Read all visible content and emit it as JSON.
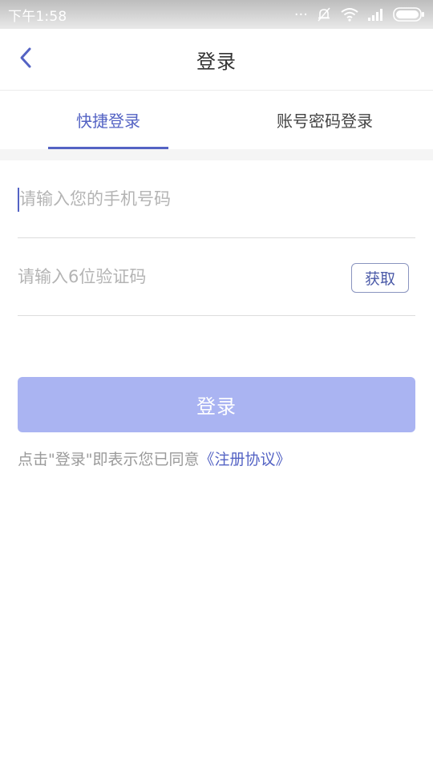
{
  "status_bar": {
    "time": "下午1:58",
    "dots": "..."
  },
  "header": {
    "title": "登录"
  },
  "tabs": [
    {
      "label": "快捷登录",
      "active": true
    },
    {
      "label": "账号密码登录",
      "active": false
    }
  ],
  "form": {
    "phone_placeholder": "请输入您的手机号码",
    "code_placeholder": "请输入6位验证码",
    "get_code_label": "获取"
  },
  "login_button": {
    "label": "登录"
  },
  "agreement": {
    "text": "点击\"登录\"即表示您已同意",
    "link": "《注册协议》"
  },
  "colors": {
    "accent": "#5463c4",
    "button_bg": "#aab4f2",
    "placeholder": "#b4b4b4"
  }
}
